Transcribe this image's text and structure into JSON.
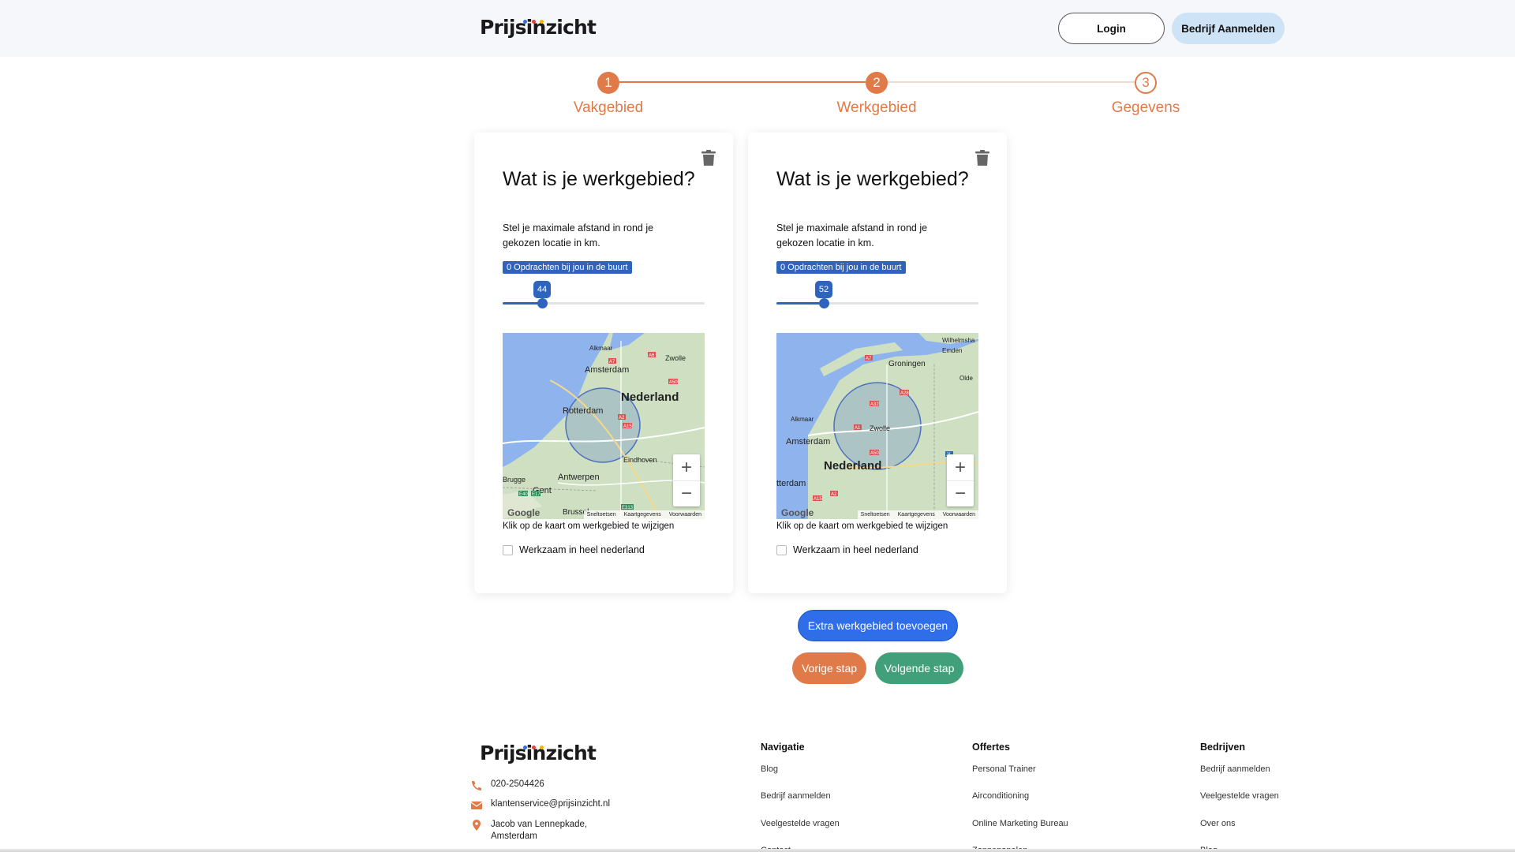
{
  "header": {
    "logo": "Prijsinzicht",
    "login_label": "Login",
    "register_label": "Bedrijf Aanmelden"
  },
  "steps": [
    {
      "number": "1",
      "label": "Vakgebied",
      "state": "done"
    },
    {
      "number": "2",
      "label": "Werkgebied",
      "state": "done"
    },
    {
      "number": "3",
      "label": "Gegevens",
      "state": "todo"
    }
  ],
  "cards": [
    {
      "title": "Wat is je werkgebied?",
      "description": "Stel je maximale afstand in rond je gekozen locatie in km.",
      "badge": "0 Opdrachten bij jou in de buurt",
      "slider_value": "44",
      "slider_fraction": 0.195,
      "map": {
        "cities": [
          "Alkmaar",
          "Zwolle",
          "Amsterdam",
          "Nederland",
          "Rotterdam",
          "Eindhoven",
          "Antwerpen",
          "Brugge",
          "Gent",
          "Brussel"
        ],
        "roads": [
          "A7",
          "A6",
          "A50",
          "A2",
          "A15",
          "E40",
          "E17",
          "E313"
        ]
      },
      "map_hint": "Klik op de kaart om werkgebied te wijzigen",
      "checkbox_label": "Werkzaam in heel nederland"
    },
    {
      "title": "Wat is je werkgebied?",
      "description": "Stel je maximale afstand in rond je gekozen locatie in km.",
      "badge": "0 Opdrachten bij jou in de buurt",
      "slider_value": "52",
      "slider_fraction": 0.236,
      "map": {
        "cities": [
          "Wilhelmsha",
          "Emden",
          "Groningen",
          "Olde",
          "Alkmaar",
          "Zwolle",
          "Amsterdam",
          "Nederland",
          "tterdam"
        ],
        "roads": [
          "A7",
          "A32",
          "A28",
          "A50",
          "A1",
          "A2",
          "A15",
          "J1"
        ]
      },
      "map_hint": "Klik op de kaart om werkgebied te wijzigen",
      "checkbox_label": "Werkzaam in heel nederland"
    }
  ],
  "map_attribution": {
    "google": "Google",
    "shortcuts": "Sneltoetsen",
    "map_data": "Kaartgegevens",
    "terms": "Voorwaarden"
  },
  "map_controls": {
    "zoom_in": "+",
    "zoom_out": "−"
  },
  "actions": {
    "extra_label": "Extra werkgebied toevoegen",
    "prev_label": "Vorige stap",
    "next_label": "Volgende stap"
  },
  "footer": {
    "logo": "Prijsinzicht",
    "phone": "020-2504426",
    "email": "klantenservice@prijsinzicht.nl",
    "address_line1": "Jacob van Lennepkade,",
    "address_line2": "Amsterdam",
    "columns": [
      {
        "title": "Navigatie",
        "links": [
          "Blog",
          "Bedrijf aanmelden",
          "Veelgestelde vragen",
          "Contact"
        ]
      },
      {
        "title": "Offertes",
        "links": [
          "Personal Trainer",
          "Airconditioning",
          "Online Marketing Bureau",
          "Zonnepanelen"
        ]
      },
      {
        "title": "Bedrijven",
        "links": [
          "Bedrijf aanmelden",
          "Veelgestelde vragen",
          "Over ons",
          "Blog"
        ]
      }
    ]
  },
  "colors": {
    "accent_orange": "#e07a48",
    "primary_blue": "#2f6ee8",
    "slider_blue": "#2f64bd",
    "success_green": "#41a07a",
    "header_bg": "#f6f7fb",
    "register_bg": "#cfe3f7"
  },
  "icons": [
    "trash-icon",
    "phone-icon",
    "email-icon",
    "location-pin-icon",
    "zoom-in-icon",
    "zoom-out-icon"
  ]
}
